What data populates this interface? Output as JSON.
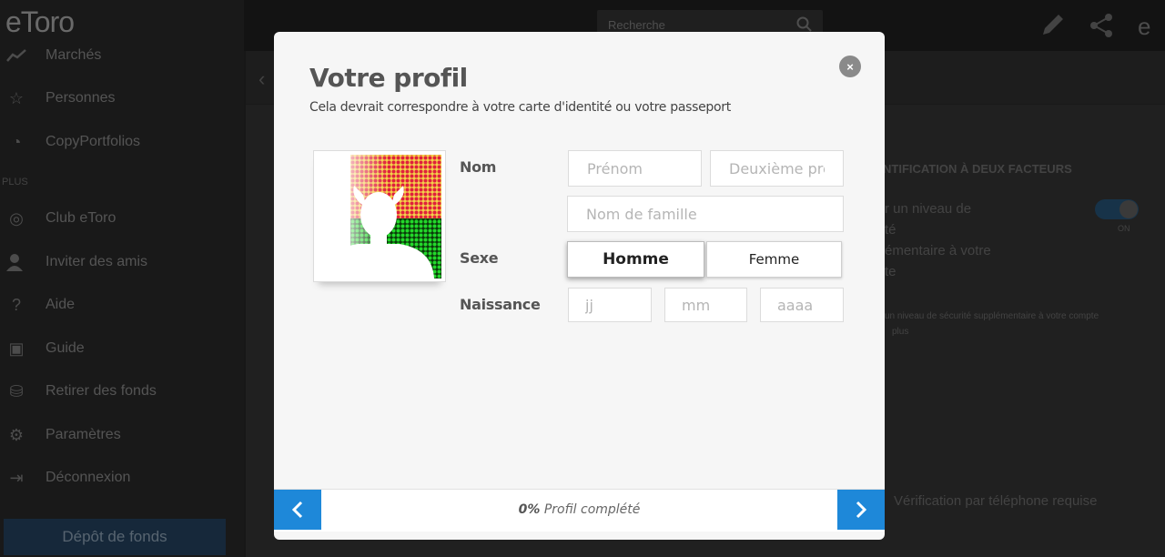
{
  "background": {
    "logo": "eToro",
    "nav_items": [
      "Marchés",
      "Personnes",
      "CopyPortfolios",
      "Club eToro",
      "Inviter des amis",
      "Aide",
      "Guide",
      "Retirer des fonds",
      "Paramètres",
      "Déconnexion"
    ],
    "section_label": "PLUS",
    "deposit_button": "Dépôt de fonds",
    "search_placeholder": "Recherche",
    "two_factor_heading": "NTIFICATION À DEUX FACTEURS",
    "two_factor_lines": [
      "r un niveau de",
      "té",
      "émentaire à votre",
      "te"
    ],
    "toggle_label": "ON",
    "small_note_lines": [
      "un niveau de sécurité supplémentaire à votre compte",
      "plus"
    ],
    "phone_verification": "Vérification par téléphone requise"
  },
  "modal": {
    "title": "Votre profil",
    "subtitle": "Cela devrait correspondre à votre carte d'identité ou votre passeport",
    "close_label": "×",
    "labels": {
      "name": "Nom",
      "gender": "Sexe",
      "birth": "Naissance"
    },
    "placeholders": {
      "first_name": "Prénom",
      "middle_name": "Deuxième prénom",
      "last_name": "Nom de famille",
      "day": "jj",
      "month": "mm",
      "year": "aaaa"
    },
    "gender_options": {
      "male": "Homme",
      "female": "Femme"
    },
    "progress_percent": "0%",
    "progress_text": "Profil complété"
  },
  "colors": {
    "accent": "#1e88d9",
    "overlay": "#000000"
  }
}
